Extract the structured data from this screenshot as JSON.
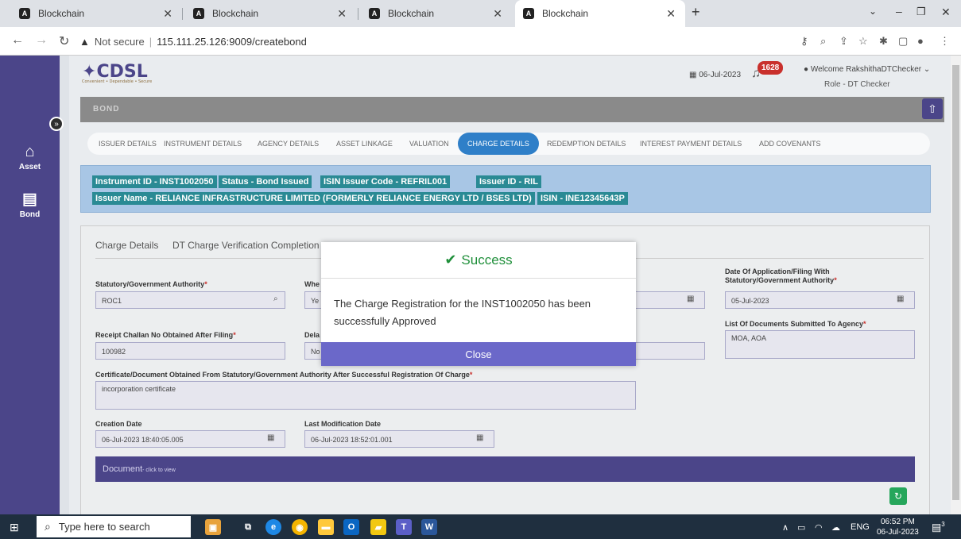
{
  "browser": {
    "tabs": [
      {
        "label": "Blockchain"
      },
      {
        "label": "Blockchain"
      },
      {
        "label": "Blockchain"
      },
      {
        "label": "Blockchain"
      }
    ],
    "security": "Not secure",
    "url": "115.111.25.126:9009/createbond"
  },
  "header": {
    "logo": "CDSL",
    "tagline": "Convenient • Dependable • Secure",
    "date": "06-Jul-2023",
    "notification_count": "1628",
    "welcome": "Welcome RakshithaDTChecker",
    "role": "Role - DT Checker"
  },
  "sidebar": {
    "items": [
      {
        "label": "Asset",
        "icon": "home-icon"
      },
      {
        "label": "Bond",
        "icon": "id-card-icon"
      }
    ]
  },
  "section_title": "BOND",
  "nav_tabs": [
    {
      "label": "ISSUER DETAILS"
    },
    {
      "label": "INSTRUMENT DETAILS"
    },
    {
      "label": "AGENCY DETAILS"
    },
    {
      "label": "ASSET LINKAGE"
    },
    {
      "label": "VALUATION"
    },
    {
      "label": "CHARGE DETAILS"
    },
    {
      "label": "REDEMPTION DETAILS"
    },
    {
      "label": "INTEREST PAYMENT DETAILS"
    },
    {
      "label": "ADD COVENANTS"
    }
  ],
  "info_chips": [
    "Instrument ID - INST1002050",
    "Status - Bond Issued",
    "ISIN Issuer Code - REFRIL001",
    "Issuer ID - RIL",
    "Issuer Name - RELIANCE INFRASTRUCTURE LIMITED (FORMERLY RELIANCE ENERGY LTD / BSES LTD)",
    "ISIN - INE12345643P"
  ],
  "sub_tabs": [
    {
      "label": "Charge Details"
    },
    {
      "label": "DT Charge Verification Completion"
    }
  ],
  "form": {
    "statutory_label": "Statutory/Government Authority",
    "statutory_value": "ROC1",
    "whether_label": "Whe",
    "whether_value": "Ye",
    "date_app_label_1": "Date Of Application/Filing With",
    "date_app_label_2": "Statutory/Government Authority",
    "date_app_value": "05-Jul-2023",
    "receipt_label": "Receipt Challan No Obtained After Filing",
    "receipt_value": "100982",
    "delay_label": "Dela",
    "delay_value": "No",
    "docs_label": "List Of Documents Submitted To Agency",
    "docs_value": "MOA, AOA",
    "certificate_label": "Certificate/Document Obtained From Statutory/Government Authority After Successful Registration Of Charge",
    "certificate_value": "incorporation certificate",
    "creation_label": "Creation Date",
    "creation_value": "06-Jul-2023 18:40:05.005",
    "lastmod_label": "Last Modification Date",
    "lastmod_value": "06-Jul-2023 18:52:01.001",
    "required_mark": "*"
  },
  "document_bar": {
    "label": "Document",
    "hint": "- click to view"
  },
  "modal": {
    "title": "Success",
    "message": "The Charge Registration for the INST1002050 has been successfully Approved",
    "close_label": "Close"
  },
  "taskbar": {
    "search_placeholder": "Type here to search",
    "language": "ENG",
    "time": "06:52 PM",
    "date": "06-Jul-2023",
    "notifications": "3"
  },
  "colors": {
    "sidebar": "#4b4589",
    "active_tab": "#2f7fc8",
    "chip": "#2a8a94",
    "success": "#1f8f3a",
    "close_button": "#6b68c9"
  }
}
